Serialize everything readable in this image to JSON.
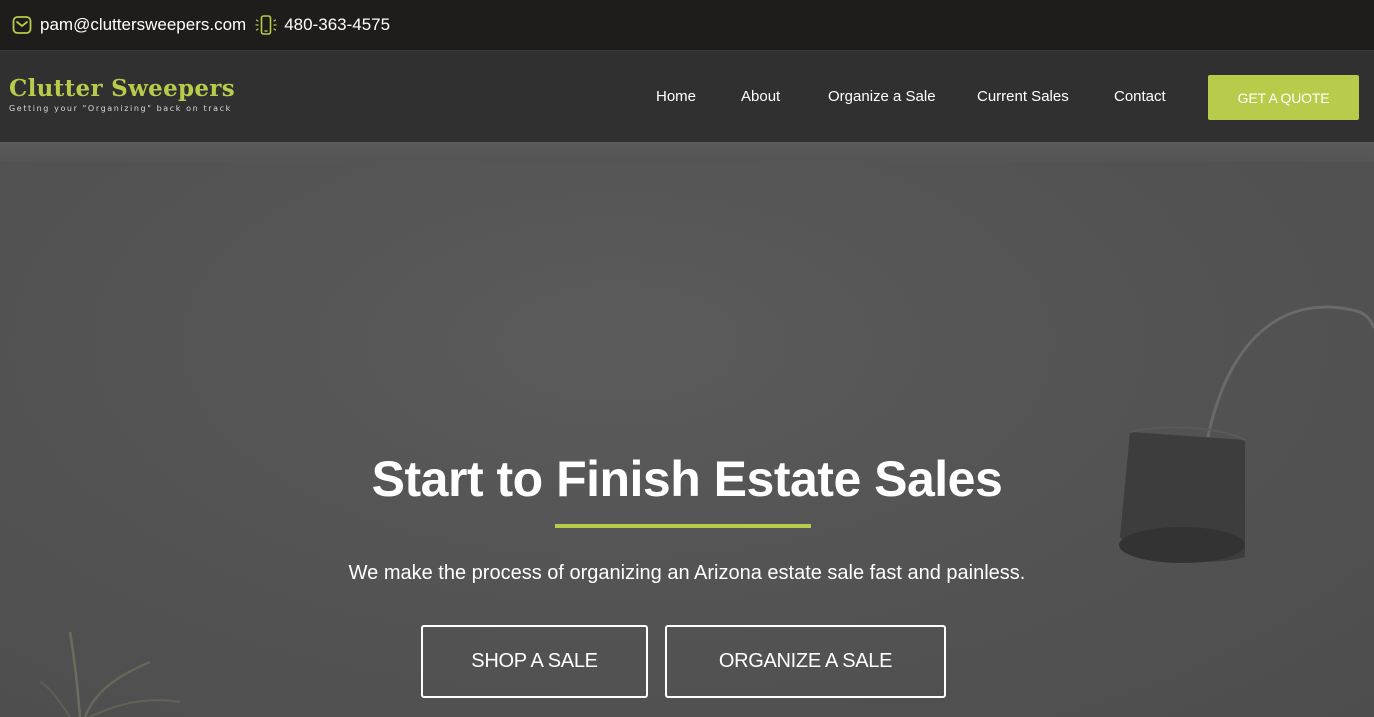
{
  "topbar": {
    "email": "pam@cluttersweepers.com",
    "phone": "480-363-4575",
    "email_icon": "envelope-icon",
    "phone_icon": "mobile-phone-icon"
  },
  "brand": {
    "title": "Clutter Sweepers",
    "tagline": "Getting your \"Organizing\" back on track"
  },
  "nav": {
    "items": [
      {
        "label": "Home"
      },
      {
        "label": "About"
      },
      {
        "label": "Organize a Sale"
      },
      {
        "label": "Current Sales"
      },
      {
        "label": "Contact"
      }
    ],
    "cta_label": "GET A QUOTE"
  },
  "hero": {
    "title": "Start to Finish Estate Sales",
    "subtitle": "We make the process of organizing an Arizona estate sale fast and painless.",
    "primary_button": "SHOP A SALE",
    "secondary_button": "ORGANIZE A SALE"
  },
  "colors": {
    "accent": "#b9cb4a",
    "topbar_bg": "#1e1d1b",
    "navbar_bg": "#303030",
    "hero_bg": "#545454"
  }
}
